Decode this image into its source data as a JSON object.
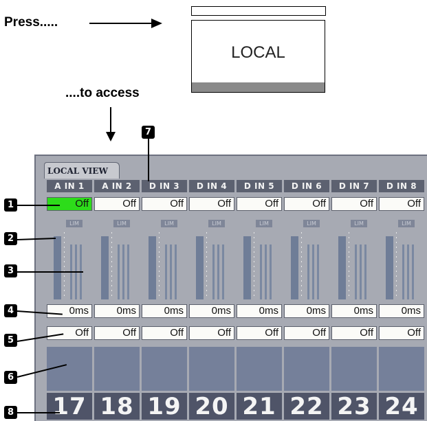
{
  "instructions": {
    "press_label": "Press.....",
    "access_label": "....to access"
  },
  "local_button": {
    "label": "LOCAL"
  },
  "panel": {
    "tab_label": "LOCAL VIEW",
    "channels": [
      {
        "name": "A IN 1",
        "mute": "Off",
        "mute_on": true,
        "lim": "LIM",
        "delay": "0ms",
        "polarity": "Off",
        "number": "17"
      },
      {
        "name": "A IN 2",
        "mute": "Off",
        "mute_on": false,
        "lim": "LIM",
        "delay": "0ms",
        "polarity": "Off",
        "number": "18"
      },
      {
        "name": "D IN 3",
        "mute": "Off",
        "mute_on": false,
        "lim": "LIM",
        "delay": "0ms",
        "polarity": "Off",
        "number": "19"
      },
      {
        "name": "D IN 4",
        "mute": "Off",
        "mute_on": false,
        "lim": "LIM",
        "delay": "0ms",
        "polarity": "Off",
        "number": "20"
      },
      {
        "name": "D IN 5",
        "mute": "Off",
        "mute_on": false,
        "lim": "LIM",
        "delay": "0ms",
        "polarity": "Off",
        "number": "21"
      },
      {
        "name": "D IN 6",
        "mute": "Off",
        "mute_on": false,
        "lim": "LIM",
        "delay": "0ms",
        "polarity": "Off",
        "number": "22"
      },
      {
        "name": "D IN 7",
        "mute": "Off",
        "mute_on": false,
        "lim": "LIM",
        "delay": "0ms",
        "polarity": "Off",
        "number": "23"
      },
      {
        "name": "D IN 8",
        "mute": "Off",
        "mute_on": false,
        "lim": "LIM",
        "delay": "0ms",
        "polarity": "Off",
        "number": "24"
      }
    ]
  },
  "callouts": [
    "1",
    "2",
    "3",
    "4",
    "5",
    "6",
    "7",
    "8"
  ],
  "colors": {
    "mute_on": "#2ddc1a",
    "panel": "#a7aab3",
    "meter": "#6f7d97"
  }
}
